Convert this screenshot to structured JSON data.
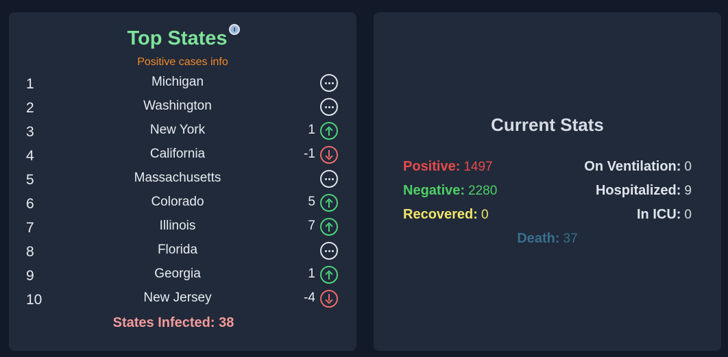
{
  "top_states": {
    "title": "Top States",
    "subtitle": "Positive cases info",
    "rows": [
      {
        "rank": "1",
        "state": "Michigan",
        "change": "",
        "trend": "neutral"
      },
      {
        "rank": "2",
        "state": "Washington",
        "change": "",
        "trend": "neutral"
      },
      {
        "rank": "3",
        "state": "New York",
        "change": "1",
        "trend": "up"
      },
      {
        "rank": "4",
        "state": "California",
        "change": "-1",
        "trend": "down"
      },
      {
        "rank": "5",
        "state": "Massachusetts",
        "change": "",
        "trend": "neutral"
      },
      {
        "rank": "6",
        "state": "Colorado",
        "change": "5",
        "trend": "up"
      },
      {
        "rank": "7",
        "state": "Illinois",
        "change": "7",
        "trend": "up"
      },
      {
        "rank": "8",
        "state": "Florida",
        "change": "",
        "trend": "neutral"
      },
      {
        "rank": "9",
        "state": "Georgia",
        "change": "1",
        "trend": "up"
      },
      {
        "rank": "10",
        "state": "New Jersey",
        "change": "-4",
        "trend": "down"
      }
    ],
    "infected_text": "States Infected: 38"
  },
  "current_stats": {
    "title": "Current Stats",
    "positive": {
      "label": "Positive:",
      "value": "1497",
      "color": "#e84a4a"
    },
    "negative": {
      "label": "Negative:",
      "value": "2280",
      "color": "#4fcf66"
    },
    "recovered": {
      "label": "Recovered:",
      "value": "0",
      "color": "#f2e46a"
    },
    "death": {
      "label": "Death:",
      "value": "37",
      "color": "#3a6f8e"
    },
    "on_ventilation": {
      "label": "On Ventilation:",
      "value": "0"
    },
    "hospitalized": {
      "label": "Hospitalized:",
      "value": "9"
    },
    "in_icu": {
      "label": "In ICU:",
      "value": "0"
    }
  },
  "colors": {
    "background": "#121a2a",
    "card": "#202a3a",
    "title_green": "#7ee29a",
    "subtitle_orange": "#f5892a",
    "infected_pink": "#f59a9a",
    "trend_up": "#4fd37a",
    "trend_down": "#ef6a6a"
  }
}
